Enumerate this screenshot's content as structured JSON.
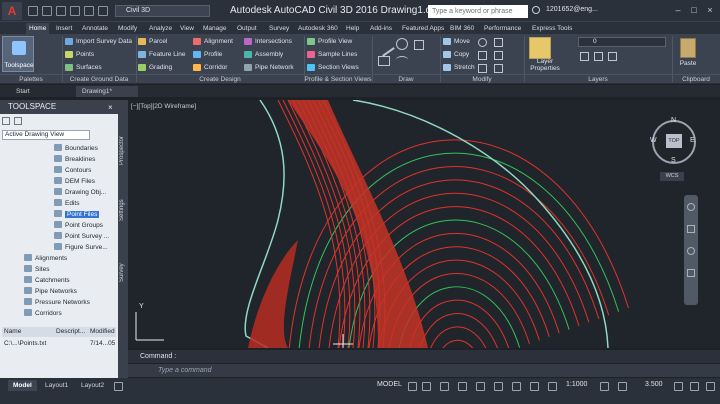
{
  "titlebar": {
    "workspace": "Civil 3D",
    "title": "Autodesk AutoCAD Civil 3D 2016    Drawing1.dwg",
    "search_placeholder": "Type a keyword or phrase",
    "user": "1201652@eng..."
  },
  "menu_tabs": [
    "Home",
    "Insert",
    "Annotate",
    "Modify",
    "Analyze",
    "View",
    "Manage",
    "Output",
    "Survey",
    "Autodesk 360",
    "Help",
    "Add-ins",
    "Featured Apps",
    "BIM 360",
    "Performance",
    "Express Tools"
  ],
  "ribbon": {
    "toolspace": "Toolspace",
    "ground_data": [
      "Import Survey Data",
      "Points",
      "Surfaces"
    ],
    "design_col1": [
      "Parcel",
      "Feature Line",
      "Grading"
    ],
    "design_col2": [
      "Alignment",
      "Profile",
      "Corridor"
    ],
    "design_col3": [
      "Intersections",
      "Assembly",
      "Pipe Network"
    ],
    "profile_section": [
      "Profile View",
      "Sample Lines",
      "Section Views"
    ],
    "modify_items": [
      "Move",
      "Copy",
      "Stretch"
    ],
    "layer_value": "0",
    "layer_properties": "Layer Properties",
    "paste": "Paste",
    "panels": [
      "Palettes",
      "Create Ground Data",
      "Create Design",
      "Profile & Section Views",
      "Draw",
      "Modify",
      "Layers",
      "Clipboard"
    ]
  },
  "doc_tabs": [
    "Start",
    "Drawing1*"
  ],
  "toolspace": {
    "header": "TOOLSPACE",
    "view": "Active Drawing View",
    "tree": [
      "Boundaries",
      "Breaklines",
      "Contours",
      "DEM Files",
      "Drawing Obj...",
      "Edits",
      "Point Files",
      "Point Groups",
      "Point Survey ...",
      "Figure Surve...",
      "Alignments",
      "Sites",
      "Catchments",
      "Pipe Networks",
      "Pressure Networks",
      "Corridors"
    ],
    "side_tabs": [
      "Prospector",
      "Settings",
      "Survey"
    ],
    "list_headers": [
      "Name",
      "Descript...",
      "Modified"
    ],
    "list_row": [
      "C:\\...\\Points.txt",
      "",
      "7/14...05"
    ]
  },
  "viewport": {
    "label": "[−][Top][2D Wireframe]",
    "cube_top": "TOP",
    "compass": [
      "N",
      "E",
      "S",
      "W"
    ],
    "wcs": "WCS",
    "axis_y": "Y"
  },
  "command": {
    "history": "Command :",
    "placeholder": "Type  a  command"
  },
  "statusbar": {
    "layouts": [
      "Model",
      "Layout1",
      "Layout2"
    ],
    "model": "MODEL",
    "scale": "1:1000",
    "value": "3.500"
  },
  "colors": {
    "contour_major": "#e0342a",
    "contour_minor": "#35c25a",
    "boundary": "#8fd9c0",
    "background": "#20242b"
  }
}
